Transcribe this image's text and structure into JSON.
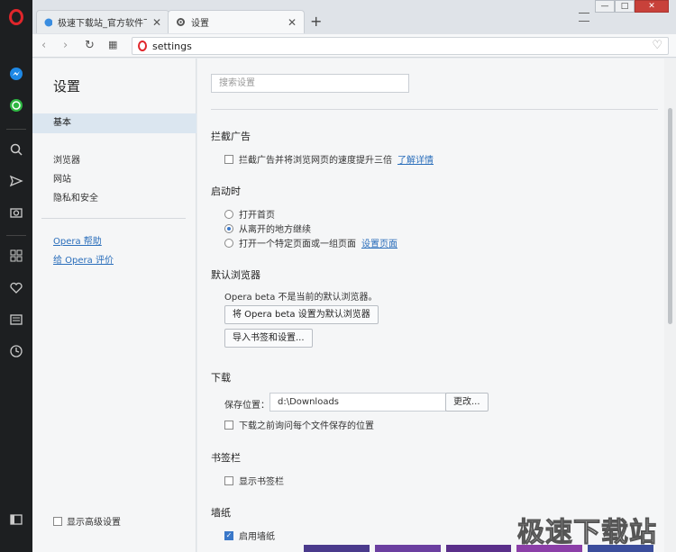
{
  "tabs": [
    {
      "title": "极速下载站_官方软件下载",
      "close": "✕"
    },
    {
      "title": "设置",
      "close": "✕"
    }
  ],
  "new_tab": "+",
  "window": {
    "min": "—",
    "max": "□",
    "close": "✕"
  },
  "address": {
    "url": "settings"
  },
  "sidebar": {
    "title": "设置",
    "items": [
      "基本",
      "浏览器",
      "网站",
      "隐私和安全"
    ],
    "links": [
      "Opera 帮助",
      "给 Opera 评价"
    ],
    "advanced": "显示高级设置"
  },
  "main": {
    "search_placeholder": "搜索设置",
    "adblock": {
      "title": "拦截广告",
      "option": "拦截广告并将浏览网页的速度提升三倍",
      "link": "了解详情"
    },
    "startup": {
      "title": "启动时",
      "options": [
        "打开首页",
        "从离开的地方继续",
        "打开一个特定页面或一组页面"
      ],
      "selected": 1,
      "link": "设置页面"
    },
    "default_browser": {
      "title": "默认浏览器",
      "status": "Opera beta 不是当前的默认浏览器。",
      "set_button": "将 Opera beta 设置为默认浏览器",
      "import_button": "导入书签和设置..."
    },
    "download": {
      "title": "下载",
      "label": "保存位置：",
      "path": "d:\\Downloads",
      "change_button": "更改...",
      "ask_option": "下载之前询问每个文件保存的位置"
    },
    "bookmarks": {
      "title": "书签栏",
      "option": "显示书签栏"
    },
    "wallpaper": {
      "title": "墙纸",
      "option": "启用墙纸"
    }
  },
  "watermark": "极速下载站",
  "colors": {
    "accent": "#2a6ebb",
    "opera_red": "#e0262b",
    "rail": "#1d1f21"
  }
}
